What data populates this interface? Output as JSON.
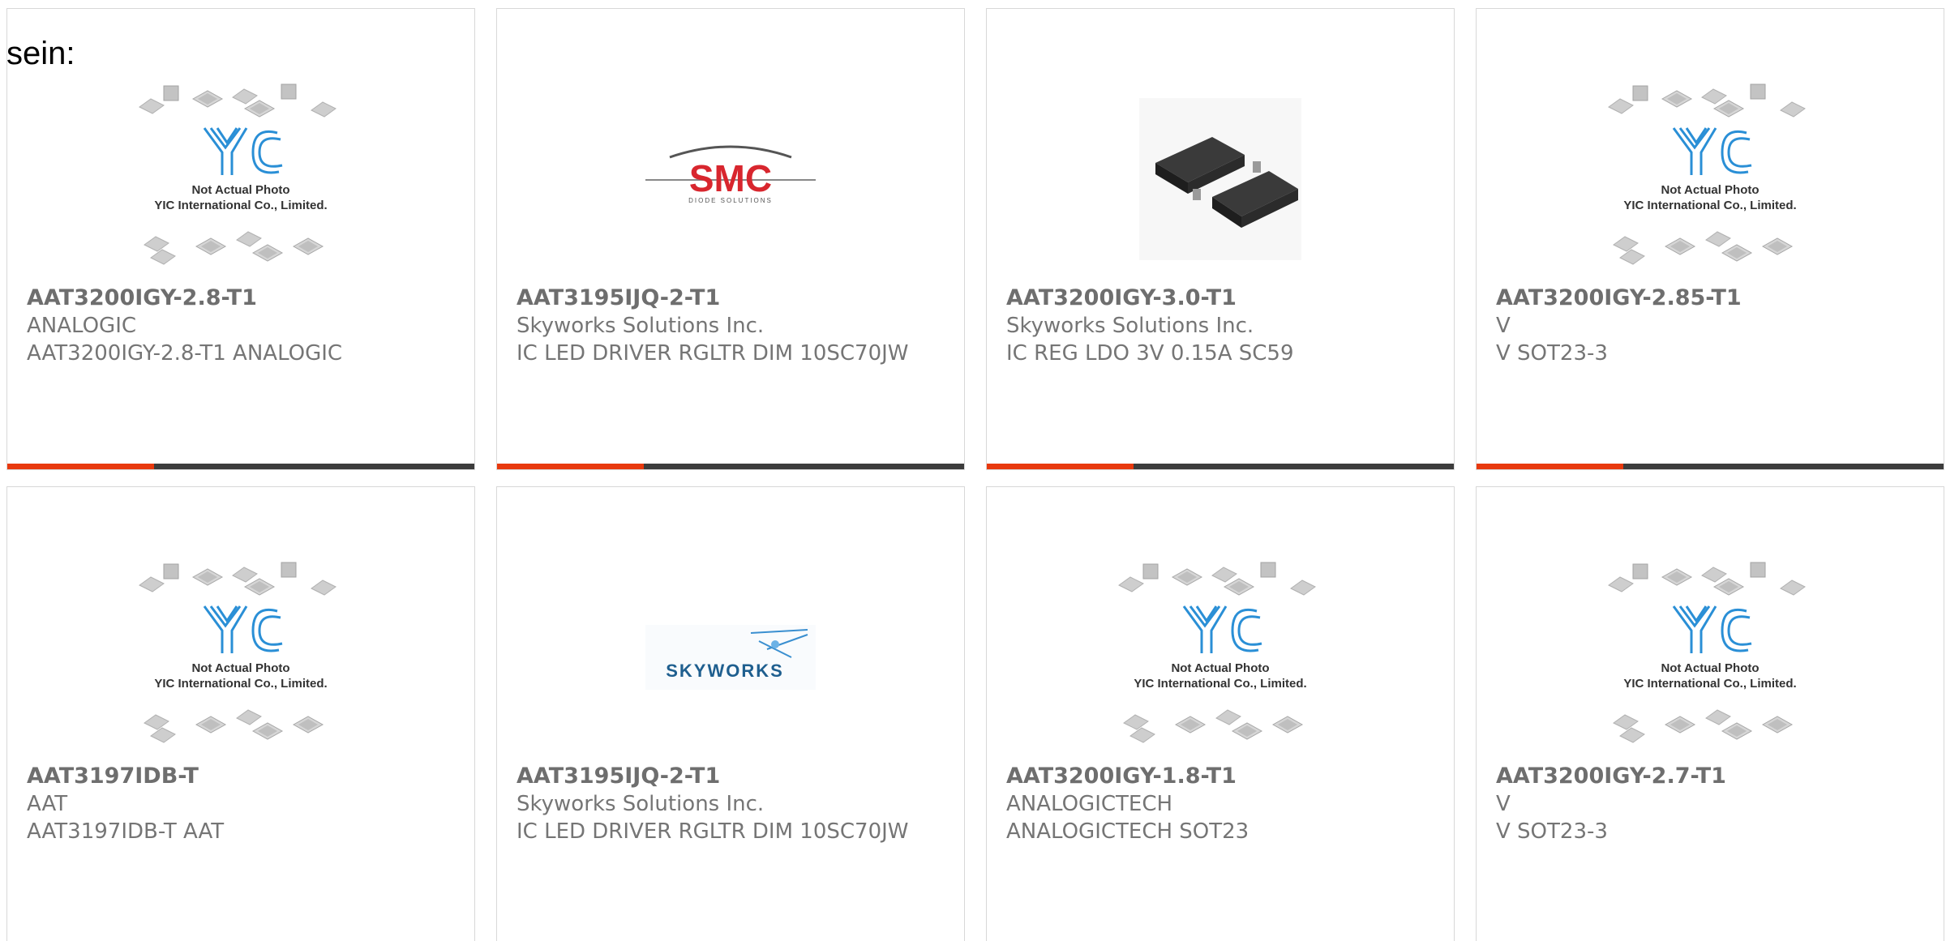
{
  "heading": "sein:",
  "placeholder_text": {
    "line1": "Not Actual Photo",
    "line2": "YIC International Co., Limited.",
    "logo": "YIC"
  },
  "logos": {
    "smc_text": "SMC",
    "smc_sub": "DIODE SOLUTIONS",
    "skyworks_text": "SKYWORKS"
  },
  "colors": {
    "accent": "#e8390e",
    "bar": "#3c3c3c",
    "text": "#757575",
    "yic_blue": "#2a8fd6",
    "smc_red": "#d8262e",
    "skyworks_blue": "#1f5f8f"
  },
  "products": [
    {
      "part": "AAT3200IGY-2.8-T1",
      "manufacturer": "ANALOGIC",
      "description": "AAT3200IGY-2.8-T1 ANALOGIC",
      "image": "yic-placeholder",
      "accent_bar": true
    },
    {
      "part": "AAT3195IJQ-2-T1",
      "manufacturer": "Skyworks Solutions Inc.",
      "description": "IC LED DRIVER RGLTR DIM 10SC70JW",
      "image": "smc-logo",
      "accent_bar": true
    },
    {
      "part": "AAT3200IGY-3.0-T1",
      "manufacturer": "Skyworks Solutions Inc.",
      "description": "IC REG LDO 3V 0.15A SC59",
      "image": "sot23-photo",
      "accent_bar": true
    },
    {
      "part": "AAT3200IGY-2.85-T1",
      "manufacturer": "V",
      "description": "V SOT23-3",
      "image": "yic-placeholder",
      "accent_bar": true
    },
    {
      "part": "AAT3197IDB-T",
      "manufacturer": "AAT",
      "description": "AAT3197IDB-T AAT",
      "image": "yic-placeholder",
      "accent_bar": false
    },
    {
      "part": "AAT3195IJQ-2-T1",
      "manufacturer": "Skyworks Solutions Inc.",
      "description": "IC LED DRIVER RGLTR DIM 10SC70JW",
      "image": "skyworks-logo",
      "accent_bar": false
    },
    {
      "part": "AAT3200IGY-1.8-T1",
      "manufacturer": "ANALOGICTECH",
      "description": "ANALOGICTECH SOT23",
      "image": "yic-placeholder",
      "accent_bar": false
    },
    {
      "part": "AAT3200IGY-2.7-T1",
      "manufacturer": "V",
      "description": "V SOT23-3",
      "image": "yic-placeholder",
      "accent_bar": false
    }
  ]
}
